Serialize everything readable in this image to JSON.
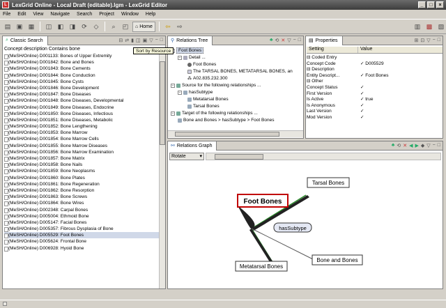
{
  "window": {
    "title": "LexGrid Online - Local Draft (editable).lgm - LexGrid Editor"
  },
  "menu": [
    "File",
    "Edit",
    "View",
    "Navigate",
    "Search",
    "Project",
    "Window",
    "Help"
  ],
  "toolbar": {
    "home_label": "Home"
  },
  "classic_search": {
    "tab_label": "Classic Search",
    "query": "Concept description Contains bone",
    "tooltip": "Sort by Resource",
    "items": [
      "(MeSH/Online) D001133: Bones of Upper Extremity",
      "(MeSH/Online) D001842: Bone and Bones",
      "(MeSH/Online) D001843: Bone Cements",
      "(MeSH/Online) D001844: Bone Conduction",
      "(MeSH/Online) D001845: Bone Cysts",
      "(MeSH/Online) D001846: Bone Development",
      "(MeSH/Online) D001847: Bone Diseases",
      "(MeSH/Online) D001848: Bone Diseases, Developmental",
      "(MeSH/Online) D001849: Bone Diseases, Endocrine",
      "(MeSH/Online) D001850: Bone Diseases, Infectious",
      "(MeSH/Online) D001851: Bone Diseases, Metabolic",
      "(MeSH/Online) D001852: Bone Lengthening",
      "(MeSH/Online) D001853: Bone Marrow",
      "(MeSH/Online) D001854: Bone Marrow Cells",
      "(MeSH/Online) D001855: Bone Marrow Diseases",
      "(MeSH/Online) D001856: Bone Marrow Examination",
      "(MeSH/Online) D001857: Bone Matrix",
      "(MeSH/Online) D001858: Bone Nails",
      "(MeSH/Online) D001859: Bone Neoplasms",
      "(MeSH/Online) D001860: Bone Plates",
      "(MeSH/Online) D001861: Bone Regeneration",
      "(MeSH/Online) D001862: Bone Resorption",
      "(MeSH/Online) D001863: Bone Screws",
      "(MeSH/Online) D001864: Bone Wires",
      "(MeSH/Online) D002348: Carpal Bones",
      "(MeSH/Online) D005004: Ethmoid Bone",
      "(MeSH/Online) D005147: Facial Bones",
      "(MeSH/Online) D005357: Fibrous Dysplasia of Bone",
      "(MeSH/Online) D005529: Foot Bones",
      "(MeSH/Online) D005624: Frontal Bone",
      "(MeSH/Online) D006928: Hyoid Bone"
    ],
    "selected_index": 28
  },
  "relations_tree": {
    "tab_label": "Relations Tree",
    "root": "Foot Bones",
    "detail": "Detail ...",
    "detail_items": [
      "Foot Bones",
      "The TARSAL BONES,  METATARSAL BONES, an",
      "A02.835.232.300"
    ],
    "source_label": "Source for the following relationships ...",
    "has_subtype": "hasSubtype",
    "subtypes": [
      "Metatarsal Bones",
      "Tarsal Bones"
    ],
    "target_label": "Target of the following relationships ...",
    "target_path": "Bone and Bones  > hasSubtype  > Foot Bones"
  },
  "properties": {
    "tab_label": "Properties",
    "col_setting": "Setting",
    "col_value": "Value",
    "rows": [
      {
        "k": "⊟ Coded Entry",
        "v": ""
      },
      {
        "k": "    Concept Code",
        "v": "✓ D005529"
      },
      {
        "k": "⊟ Description",
        "v": ""
      },
      {
        "k": "    Entity Descript...",
        "v": "✓ Foot Bones"
      },
      {
        "k": "⊟ Other",
        "v": ""
      },
      {
        "k": "    Concept Status",
        "v": "✓"
      },
      {
        "k": "    First Version",
        "v": "✓"
      },
      {
        "k": "    Is Active",
        "v": "✓ true"
      },
      {
        "k": "    Is Anonymous",
        "v": "✓"
      },
      {
        "k": "    Last Version",
        "v": "✓"
      },
      {
        "k": "    Mod Version",
        "v": "✓"
      }
    ]
  },
  "relations_graph": {
    "tab_label": "Relations Graph",
    "mode": "Rotate",
    "center": "hasSubtype",
    "focus": "Foot Bones",
    "nodes": [
      "Tarsal Bones",
      "Metatarsal Bones",
      "Bone and Bones"
    ]
  },
  "colors": {
    "selection": "#d0d8e8",
    "focus_border": "#c00000",
    "edge_dark": "#222222",
    "edge_green": "#2a8a2a"
  }
}
